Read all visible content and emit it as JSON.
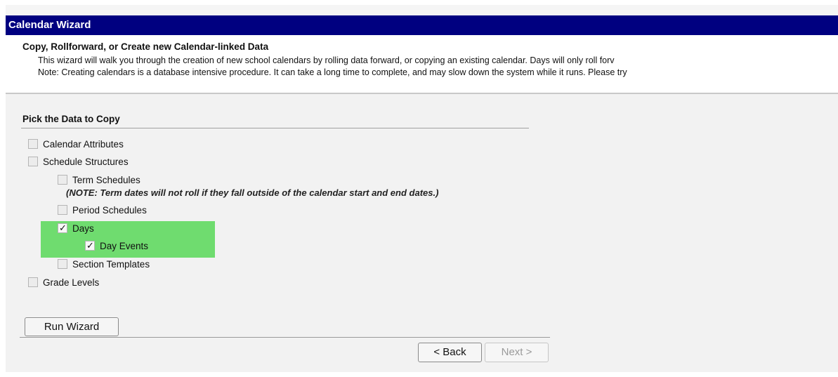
{
  "window": {
    "title": "Calendar Wizard"
  },
  "header": {
    "subtitle": "Copy, Rollforward, or Create new Calendar-linked Data",
    "description_line1": "This wizard will walk you through the creation of new school calendars by rolling data forward, or copying an existing calendar. Days will only roll forv",
    "description_line2": "Note: Creating calendars is a database intensive procedure. It can take a long time to complete, and may slow down the system while it runs. Please try"
  },
  "section": {
    "title": "Pick the Data to Copy"
  },
  "options": {
    "calendar_attributes": {
      "label": "Calendar Attributes",
      "checked": false
    },
    "schedule_structures": {
      "label": "Schedule Structures",
      "checked": false
    },
    "term_schedules": {
      "label": "Term Schedules",
      "checked": false
    },
    "term_note": "(NOTE: Term dates will not roll if they fall outside of the calendar start and end dates.)",
    "period_schedules": {
      "label": "Period Schedules",
      "checked": false
    },
    "days": {
      "label": "Days",
      "checked": true
    },
    "day_events": {
      "label": "Day Events",
      "checked": true
    },
    "section_templates": {
      "label": "Section Templates",
      "checked": false
    },
    "grade_levels": {
      "label": "Grade Levels",
      "checked": false
    }
  },
  "buttons": {
    "run_wizard": "Run Wizard",
    "back": "< Back",
    "next": "Next >"
  },
  "colors": {
    "title_bar": "#000080",
    "highlight": "#6fdc6f"
  },
  "icons": {
    "checkmark": "check-icon"
  }
}
